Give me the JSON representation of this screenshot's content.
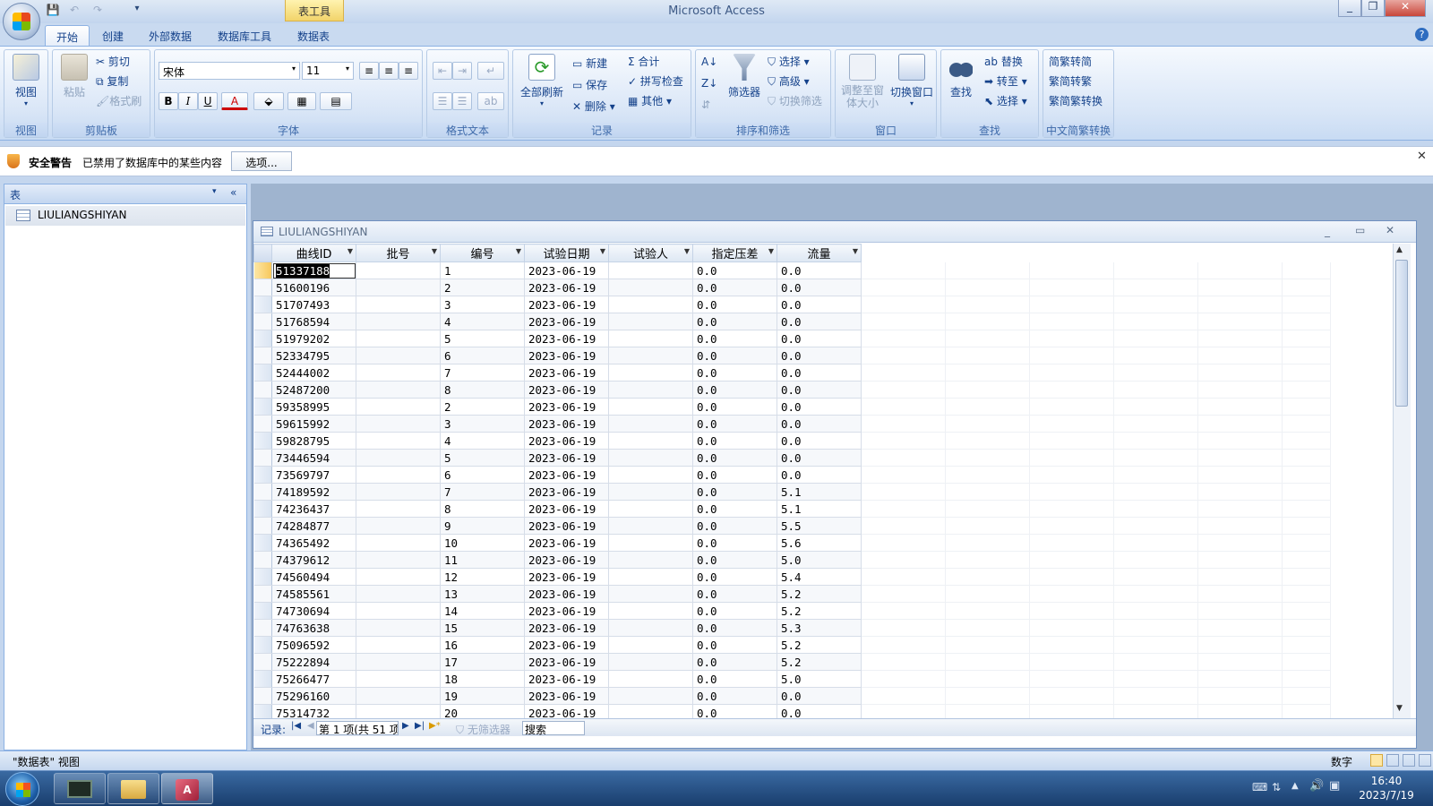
{
  "window": {
    "title": "Microsoft Access",
    "context_tab": "表工具"
  },
  "tabs": [
    "开始",
    "创建",
    "外部数据",
    "数据库工具",
    "数据表"
  ],
  "ribbon": {
    "view": {
      "label": "视图",
      "group": "视图"
    },
    "clipboard": {
      "paste": "粘贴",
      "cut": "剪切",
      "copy": "复制",
      "format_painter": "格式刷",
      "group": "剪贴板"
    },
    "font": {
      "name": "宋体",
      "size": "11",
      "bold": "B",
      "italic": "I",
      "underline": "U",
      "color_a": "A",
      "group": "字体"
    },
    "rich_text": {
      "group": "格式文本"
    },
    "records": {
      "refresh": "全部刷新",
      "new": "新建",
      "save": "保存",
      "delete": "删除",
      "totals": "合计",
      "spelling": "拼写检查",
      "more": "其他",
      "group": "记录"
    },
    "sort_filter": {
      "filter": "筛选器",
      "selection": "选择",
      "advanced": "高级",
      "toggle_filter": "切换筛选",
      "group": "排序和筛选"
    },
    "window": {
      "size_to_fit": "调整至窗体大小",
      "switch": "切换窗口",
      "group": "窗口"
    },
    "find": {
      "find": "查找",
      "replace": "替换",
      "goto": "转至",
      "select": "选择",
      "group": "查找"
    },
    "chinese": {
      "t2s": "繁转简",
      "s2t": "简转繁",
      "convert": "简繁转换",
      "group": "中文简繁转换"
    }
  },
  "security": {
    "label": "安全警告",
    "message": "已禁用了数据库中的某些内容",
    "options_button": "选项..."
  },
  "nav": {
    "header": "表",
    "item": "LIULIANGSHIYAN"
  },
  "document": {
    "title": "LIULIANGSHIYAN"
  },
  "table": {
    "columns": [
      "曲线ID",
      "批号",
      "编号",
      "试验日期",
      "试验人",
      "指定压差",
      "流量"
    ],
    "rows": [
      [
        "51337188",
        "",
        "1",
        "2023-06-19",
        "",
        "0.0",
        "0.0"
      ],
      [
        "51600196",
        "",
        "2",
        "2023-06-19",
        "",
        "0.0",
        "0.0"
      ],
      [
        "51707493",
        "",
        "3",
        "2023-06-19",
        "",
        "0.0",
        "0.0"
      ],
      [
        "51768594",
        "",
        "4",
        "2023-06-19",
        "",
        "0.0",
        "0.0"
      ],
      [
        "51979202",
        "",
        "5",
        "2023-06-19",
        "",
        "0.0",
        "0.0"
      ],
      [
        "52334795",
        "",
        "6",
        "2023-06-19",
        "",
        "0.0",
        "0.0"
      ],
      [
        "52444002",
        "",
        "7",
        "2023-06-19",
        "",
        "0.0",
        "0.0"
      ],
      [
        "52487200",
        "",
        "8",
        "2023-06-19",
        "",
        "0.0",
        "0.0"
      ],
      [
        "59358995",
        "",
        "2",
        "2023-06-19",
        "",
        "0.0",
        "0.0"
      ],
      [
        "59615992",
        "",
        "3",
        "2023-06-19",
        "",
        "0.0",
        "0.0"
      ],
      [
        "59828795",
        "",
        "4",
        "2023-06-19",
        "",
        "0.0",
        "0.0"
      ],
      [
        "73446594",
        "",
        "5",
        "2023-06-19",
        "",
        "0.0",
        "0.0"
      ],
      [
        "73569797",
        "",
        "6",
        "2023-06-19",
        "",
        "0.0",
        "0.0"
      ],
      [
        "74189592",
        "",
        "7",
        "2023-06-19",
        "",
        "0.0",
        "5.1"
      ],
      [
        "74236437",
        "",
        "8",
        "2023-06-19",
        "",
        "0.0",
        "5.1"
      ],
      [
        "74284877",
        "",
        "9",
        "2023-06-19",
        "",
        "0.0",
        "5.5"
      ],
      [
        "74365492",
        "",
        "10",
        "2023-06-19",
        "",
        "0.0",
        "5.6"
      ],
      [
        "74379612",
        "",
        "11",
        "2023-06-19",
        "",
        "0.0",
        "5.0"
      ],
      [
        "74560494",
        "",
        "12",
        "2023-06-19",
        "",
        "0.0",
        "5.4"
      ],
      [
        "74585561",
        "",
        "13",
        "2023-06-19",
        "",
        "0.0",
        "5.2"
      ],
      [
        "74730694",
        "",
        "14",
        "2023-06-19",
        "",
        "0.0",
        "5.2"
      ],
      [
        "74763638",
        "",
        "15",
        "2023-06-19",
        "",
        "0.0",
        "5.3"
      ],
      [
        "75096592",
        "",
        "16",
        "2023-06-19",
        "",
        "0.0",
        "5.2"
      ],
      [
        "75222894",
        "",
        "17",
        "2023-06-19",
        "",
        "0.0",
        "5.2"
      ],
      [
        "75266477",
        "",
        "18",
        "2023-06-19",
        "",
        "0.0",
        "5.0"
      ],
      [
        "75296160",
        "",
        "19",
        "2023-06-19",
        "",
        "0.0",
        "0.0"
      ],
      [
        "75314732",
        "",
        "20",
        "2023-06-19",
        "",
        "0.0",
        "0.0"
      ]
    ]
  },
  "record_nav": {
    "label": "记录:",
    "position": "第 1 项(共 51 项",
    "filter": "无筛选器",
    "search": "搜索"
  },
  "status": {
    "left": "\"数据表\" 视图",
    "right": "数字"
  },
  "clock": {
    "time": "16:40",
    "date": "2023/7/19"
  }
}
